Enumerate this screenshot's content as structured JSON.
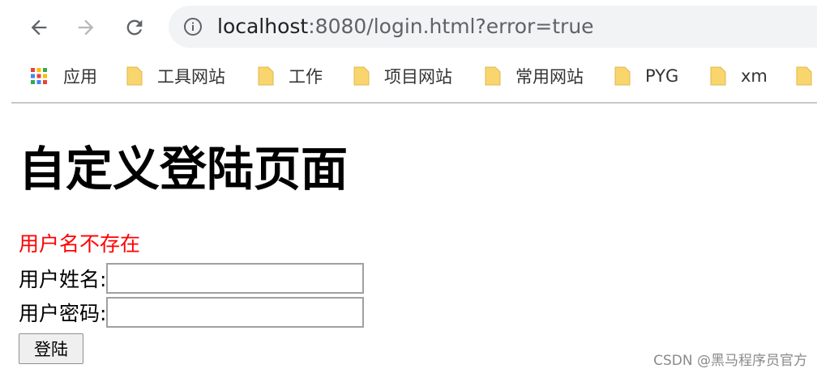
{
  "browser": {
    "url_host": "localhost",
    "url_rest": ":8080/login.html?error=true",
    "bookmarks": {
      "apps_label": "应用",
      "items": [
        "工具网站",
        "工作",
        "项目网站",
        "常用网站",
        "PYG",
        "xm"
      ]
    }
  },
  "page": {
    "title": "自定义登陆页面",
    "error_message": "用户名不存在",
    "username_label": "用户姓名:",
    "password_label": "用户密码:",
    "login_button": "登陆"
  },
  "watermark": "CSDN @黑马程序员官方",
  "colors": {
    "error": "#ff0000",
    "folder": "#f9d56e",
    "address_bar_bg": "#f1f3f4"
  },
  "icons": [
    "back-arrow-icon",
    "forward-arrow-icon",
    "reload-icon",
    "info-icon",
    "apps-grid-icon",
    "folder-icon"
  ]
}
